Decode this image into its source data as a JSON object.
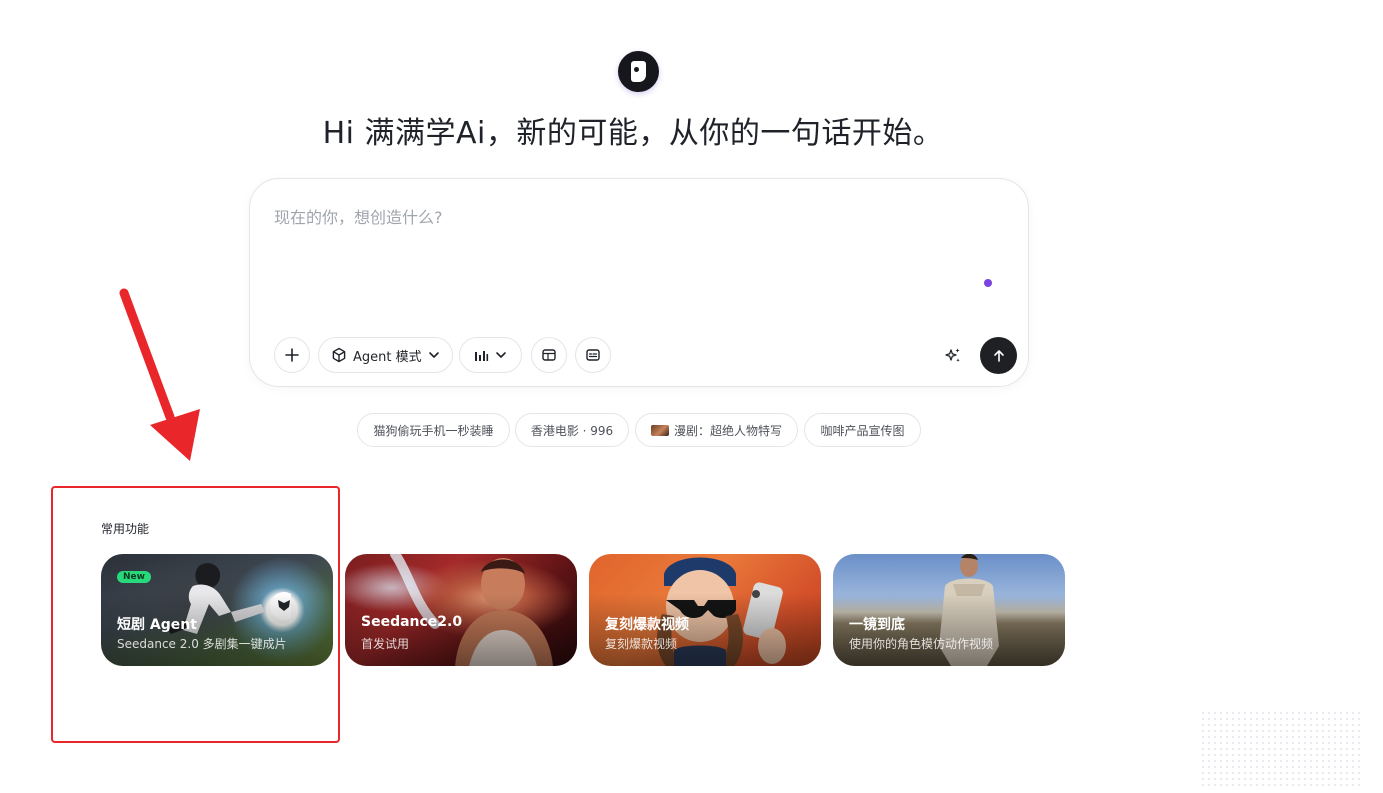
{
  "greeting": "Hi 满满学Ai，新的可能，从你的一句话开始。",
  "prompt": {
    "placeholder": "现在的你，想创造什么?",
    "value": ""
  },
  "toolbar": {
    "add_icon": "plus-icon",
    "mode_label": "Agent 模式",
    "mode_icon": "cube-icon",
    "chart_icon": "bar-chart-icon",
    "ratio_icon": "aspect-ratio-icon",
    "subtitle_icon": "subtitle-icon",
    "sparkle_icon": "sparkle-icon",
    "send_icon": "arrow-up-icon"
  },
  "suggestions": [
    {
      "label": "猫狗偷玩手机一秒装睡"
    },
    {
      "label": "香港电影 · 996"
    },
    {
      "label": "漫剧：超绝人物特写",
      "thumb": true
    },
    {
      "label": "咖啡产品宣传图"
    }
  ],
  "section": {
    "title": "常用功能"
  },
  "cards": [
    {
      "title": "短剧 Agent",
      "subtitle": "Seedance 2.0 多剧集一键成片",
      "badge": "New"
    },
    {
      "title": "Seedance2.0",
      "subtitle": "首发试用"
    },
    {
      "title": "复刻爆款视频",
      "subtitle": "复刻爆款视频"
    },
    {
      "title": "一镜到底",
      "subtitle": "使用你的角色模仿动作视频"
    }
  ],
  "colors": {
    "annotation": "#e9262a",
    "accent_dot": "#7a44e0",
    "new_badge": "#27d97a"
  }
}
